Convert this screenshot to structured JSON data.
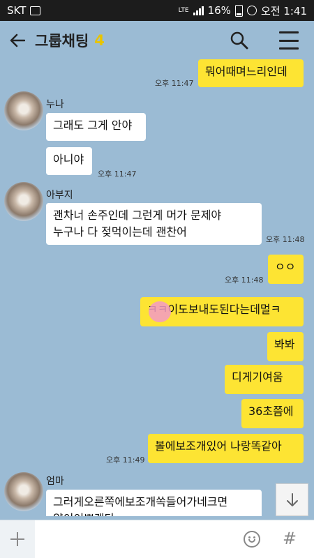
{
  "status_bar": {
    "carrier": "SKT",
    "network": "LTE",
    "battery": "16%",
    "time": "오전 1:41"
  },
  "header": {
    "title": "그룹채팅",
    "member_count": "4"
  },
  "messages": [
    {
      "from": "me",
      "text": "뭐어때며느리인데",
      "time": "오후 11:47"
    },
    {
      "from": "누나",
      "sender": "누나",
      "text": "그래도 그게 안야"
    },
    {
      "from": "누나",
      "text": "아니야",
      "time": "오후 11:47"
    },
    {
      "from": "아부지",
      "sender": "아부지",
      "line1": "괜차너 손주인데 그런게 머가 문제야",
      "line2": "누구나 다  젖먹이는데 괜찬어",
      "time": "오후 11:48"
    },
    {
      "from": "me",
      "text": "ㅇㅇ",
      "time": "오후 11:48"
    },
    {
      "from": "me",
      "text": "ㅋㅋ이도보내도된다는데멀ㅋ"
    },
    {
      "from": "me",
      "text": "봐봐"
    },
    {
      "from": "me",
      "text": "디게기여움"
    },
    {
      "from": "me",
      "text": "36초쯤에"
    },
    {
      "from": "me",
      "text": "볼에보조개있어 나랑똑같아",
      "time": "오후 11:49"
    },
    {
      "from": "엄마",
      "sender": "엄마",
      "line1": "그러게오른쪽에보조개쏙들어가네크면",
      "line2": "얍이이쁘겠다"
    }
  ],
  "input": {
    "placeholder": ""
  },
  "icons": {
    "back": "arrow-left-icon",
    "search": "search-icon",
    "menu": "hamburger-menu-icon",
    "plus": "plus-icon",
    "emoji": "emoji-icon",
    "hash": "hash-icon",
    "scroll": "arrow-down-icon"
  },
  "colors": {
    "background": "#9bbbd4",
    "my_bubble": "#fde433",
    "other_bubble": "#ffffff",
    "member_count": "#e8c400"
  }
}
